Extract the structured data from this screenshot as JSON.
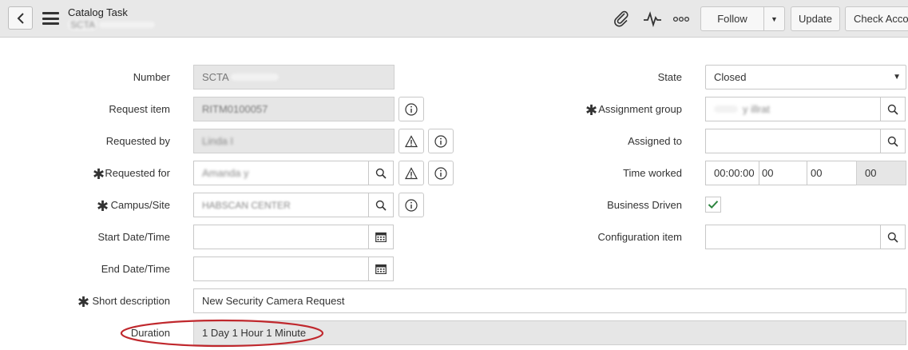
{
  "header": {
    "title": "Catalog Task",
    "subtitle": "SCTA",
    "follow_label": "Follow",
    "update_label": "Update",
    "check_label": "Check Accou"
  },
  "left_fields": [
    {
      "label": "Number",
      "value": "SCTA"
    },
    {
      "label": "Request item",
      "value": "RITM0100057"
    },
    {
      "label": "Requested by",
      "value": "Linda I"
    },
    {
      "label": "Requested for",
      "value": "Amanda y"
    },
    {
      "label": "Campus/Site",
      "value": "HABSCAN CENTER"
    },
    {
      "label": "Start Date/Time",
      "value": ""
    },
    {
      "label": "End Date/Time",
      "value": ""
    }
  ],
  "right_fields": [
    {
      "label": "State",
      "value": "Closed"
    },
    {
      "label": "Assignment group",
      "value": "y   illrat"
    },
    {
      "label": "Assigned to",
      "value": ""
    },
    {
      "label": "Time worked",
      "value": "00:00:00",
      "hours": "00",
      "minutes": "00",
      "seconds": "00"
    },
    {
      "label": "Business Driven",
      "value": ""
    },
    {
      "label": "Configuration item",
      "value": ""
    }
  ],
  "short_description": {
    "label": "Short description",
    "value": "New Security Camera Request"
  },
  "duration": {
    "label": "Duration",
    "value": "1 Day 1 Hour 1 Minute"
  },
  "colors": {
    "highlight_circle": "#c0282d",
    "checkmark": "#2e8540"
  }
}
